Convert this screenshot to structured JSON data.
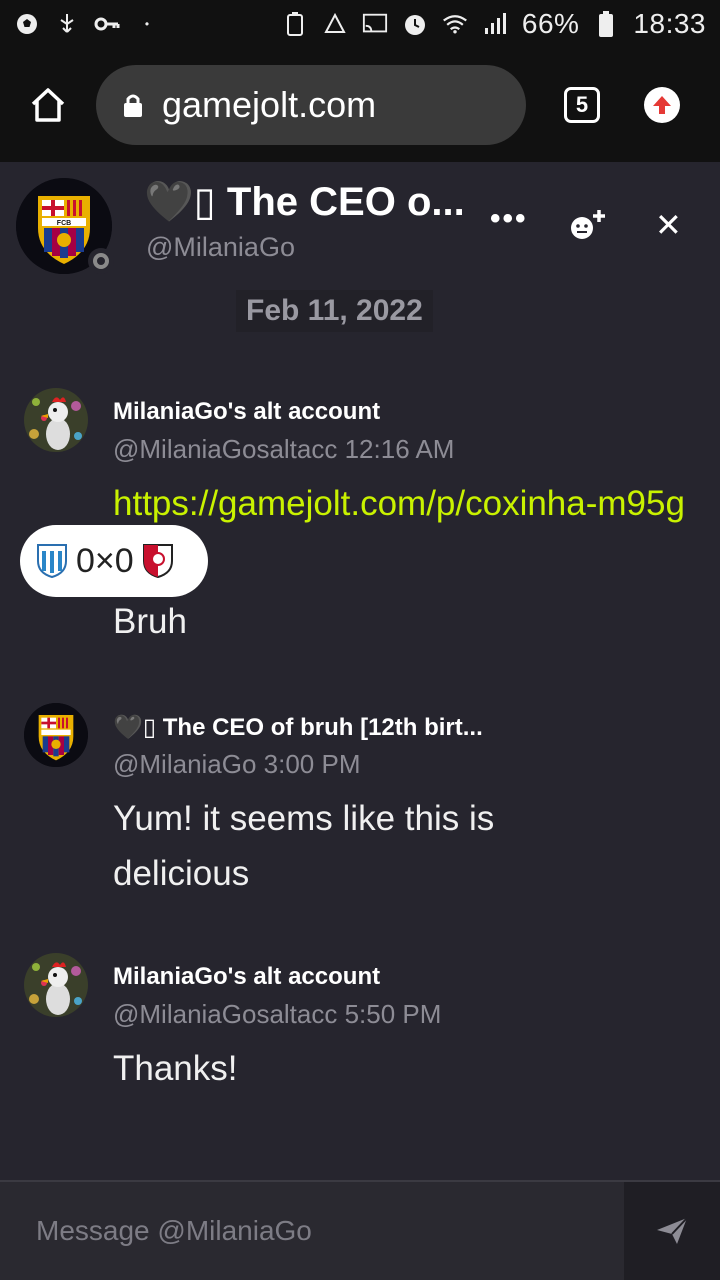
{
  "status_bar": {
    "battery": "66%",
    "time": "18:33",
    "left_icons": [
      "soccer-ball-icon",
      "usb-icon",
      "key-icon"
    ],
    "right_icons": [
      "battery-saver-icon",
      "recycle-icon",
      "cast-icon",
      "alarm-icon",
      "wifi-icon",
      "signal-icon"
    ]
  },
  "browser": {
    "url": "gamejolt.com",
    "tab_count": "5"
  },
  "chat_header": {
    "name": "🖤▯ The CEO o...",
    "handle": "@MilaniaGo",
    "more_label": "•••",
    "close_label": "✕"
  },
  "date_divider": "Feb 11, 2022",
  "messages": [
    {
      "name": "MilaniaGo's alt account",
      "meta": "@MilaniaGosaltacc 12:16 AM",
      "link": "https://gamejolt.com/p/coxinha-m95g7y",
      "text": "Bruh"
    },
    {
      "name": "🖤▯ The CEO of bruh [12th birt...",
      "meta": "@MilaniaGo 3:00 PM",
      "text": "Yum! it seems like this is delicious"
    },
    {
      "name": "MilaniaGo's alt account",
      "meta": "@MilaniaGosaltacc 5:50 PM",
      "text": "Thanks!"
    }
  ],
  "score_overlay": {
    "score": "0×0"
  },
  "composer": {
    "placeholder": "Message @MilaniaGo"
  },
  "colors": {
    "accent_link": "#c9f200",
    "chat_bg": "#26252e",
    "update_red": "#e53935"
  }
}
